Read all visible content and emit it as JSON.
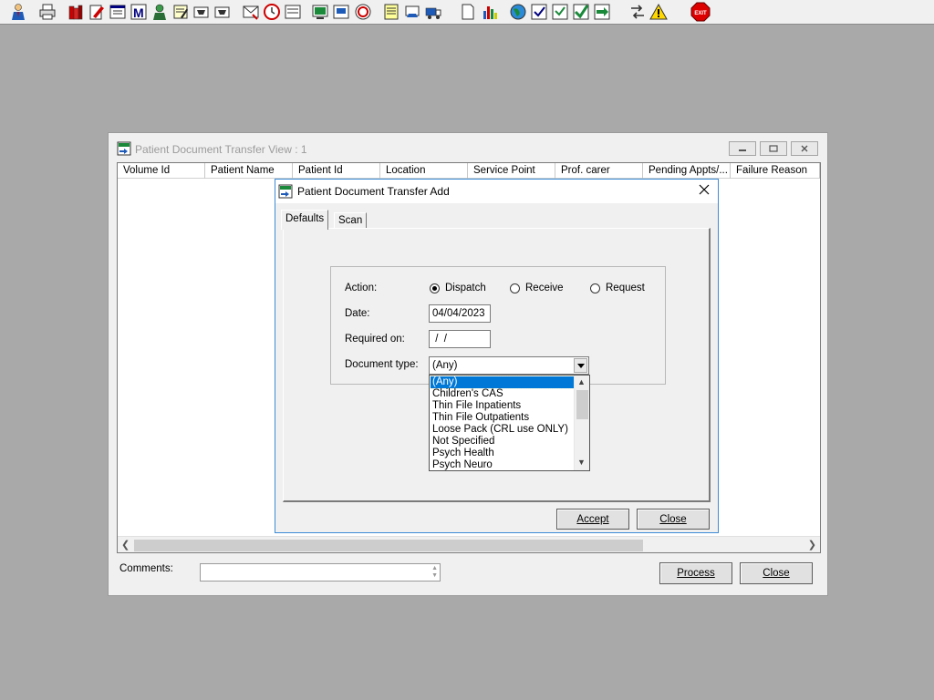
{
  "toolbar": {
    "icons": [
      "user-icon",
      "print-icon",
      "books-icon",
      "edit-form-icon",
      "list-window-icon",
      "m-icon",
      "person-icon",
      "notepad-icon",
      "flag-icon",
      "flag-icon",
      "envelope-icon",
      "clock-icon",
      "monitor-icon",
      "screen-icon",
      "document-screen-icon",
      "disc-icon",
      "notes-icon",
      "transfer-icon",
      "truck-icon",
      "blank-document-icon",
      "bar-chart-icon",
      "globe-icon",
      "check-list-icon",
      "report-icon",
      "check-green-icon",
      "arrows-green-icon",
      "swap-arrows-icon",
      "warning-icon",
      "exit-icon"
    ],
    "exit_label": "EXIT"
  },
  "mdi": {
    "title": "Patient Document Transfer View : 1",
    "columns": [
      "Volume Id",
      "Patient Name",
      "Patient Id",
      "Location",
      "Service Point",
      "Prof. carer",
      "Pending Appts/...",
      "Failure Reason"
    ],
    "comments_label": "Comments:",
    "comments_value": "",
    "process_label": "Process",
    "close_label": "Close"
  },
  "dialog": {
    "title": "Patient Document Transfer Add",
    "tabs": [
      "Defaults",
      "Scan"
    ],
    "action_label": "Action:",
    "radios": [
      "Dispatch",
      "Receive",
      "Request"
    ],
    "selected_radio": "Dispatch",
    "date_label": "Date:",
    "date_value": "04/04/2023",
    "required_label": "Required on:",
    "required_value": " /  /",
    "doctype_label": "Document type:",
    "doctype_value": "(Any)",
    "doctype_options": [
      "(Any)",
      "Children's CAS",
      "Thin File Inpatients",
      "Thin File Outpatients",
      "Loose Pack (CRL use ONLY)",
      "Not Specified",
      "Psych Health",
      "Psych Neuro"
    ],
    "accept_label": "Accept",
    "close_label": "Close"
  },
  "colors": {
    "dialog_border": "#3c8bd6",
    "selection": "#0078d7",
    "desktop": "#a9a9a9"
  }
}
